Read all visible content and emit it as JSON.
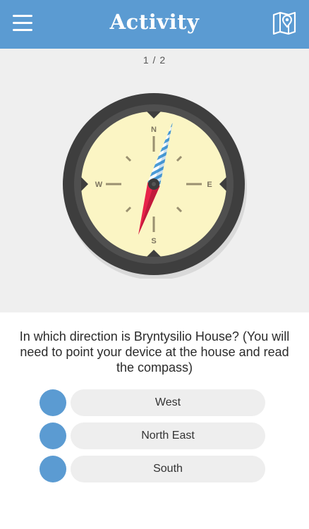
{
  "header": {
    "title": "Activity",
    "menu_icon": "hamburger-menu-icon",
    "map_icon": "map-pin-icon",
    "background_color": "#5b9bd2"
  },
  "compass_panel": {
    "page_counter": "1 / 2",
    "compass": {
      "north": "N",
      "south": "S",
      "east": "E",
      "west": "W"
    }
  },
  "question": {
    "text": "In which direction is Bryntysilio House? (You will need to point your device at the house and read the compass)"
  },
  "options": [
    {
      "label": "West"
    },
    {
      "label": "North East"
    },
    {
      "label": "South"
    }
  ]
}
